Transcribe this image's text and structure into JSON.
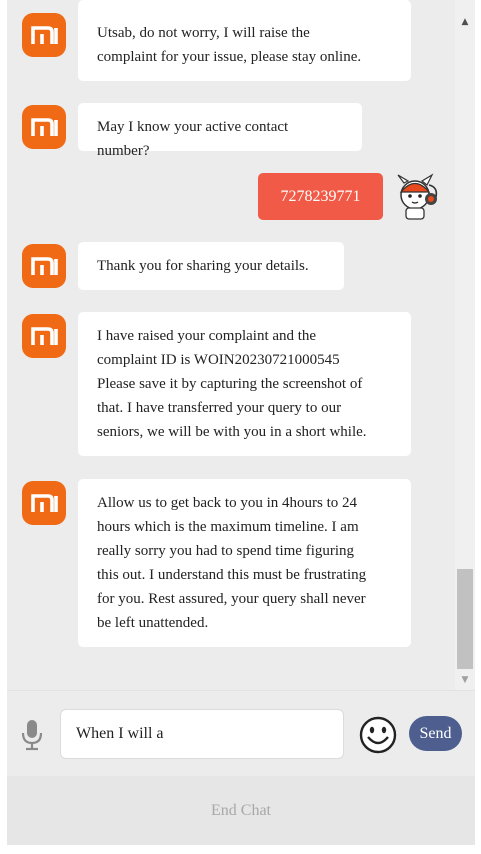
{
  "chat": {
    "messages": [
      {
        "from": "bot",
        "lines": [
          "Utsab, do not worry, I will raise the",
          "complaint for your issue, please stay online."
        ]
      },
      {
        "from": "bot",
        "lines": [
          "May I know your active contact number?"
        ]
      },
      {
        "from": "user",
        "text": "7278239771"
      },
      {
        "from": "bot",
        "lines": [
          "Thank you for sharing your details."
        ]
      },
      {
        "from": "bot",
        "lines": [
          "I have raised your complaint and the",
          "complaint ID is WOIN20230721000545",
          "Please save it by capturing the screenshot of",
          "that. I have transferred your query to our",
          "seniors, we will be with you in a short while."
        ]
      },
      {
        "from": "bot",
        "lines": [
          "Allow us to get back to you in 4hours to 24",
          "hours which is the maximum timeline. I am",
          "really sorry you had to spend time figuring",
          "this out. I understand this must be frustrating",
          "for you. Rest assured, your query shall never",
          "be left unattended."
        ]
      }
    ]
  },
  "input": {
    "value": "When I will a"
  },
  "send_label": "Send",
  "end_chat_label": "End Chat",
  "icons": {
    "bot_avatar": "xiaomi-logo-icon",
    "user_avatar": "mitu-bunny-avatar-icon",
    "mic": "microphone-icon",
    "emoji": "smiley-face-icon"
  },
  "colors": {
    "brand": "#f06a15",
    "user_bubble": "#f05a46",
    "send_button": "#4e5f8f"
  }
}
